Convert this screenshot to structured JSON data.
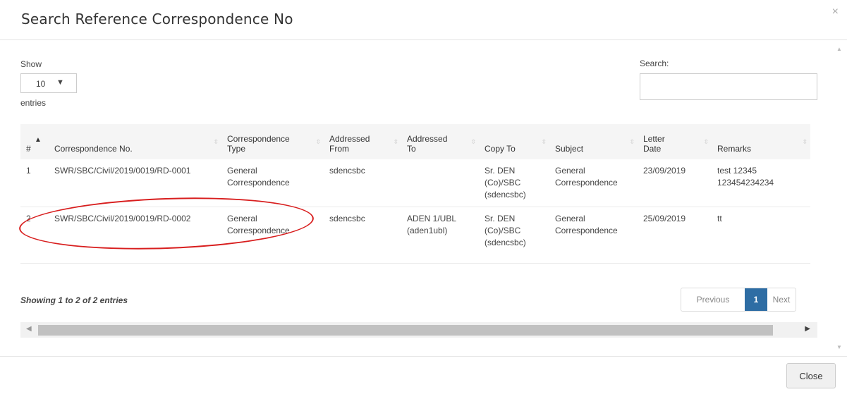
{
  "modal": {
    "title": "Search Reference Correspondence No",
    "close_symbol": "×"
  },
  "length": {
    "label_before": "Show",
    "value": "10",
    "caret": "▼",
    "label_after": "entries"
  },
  "search": {
    "label": "Search:",
    "value": ""
  },
  "table": {
    "columns": [
      "#",
      "Correspondence No.",
      "Correspondence Type",
      "Addressed From",
      "Addressed To",
      "Copy To",
      "Subject",
      "Letter Date",
      "Remarks"
    ],
    "rows": [
      {
        "num": "1",
        "corr_no": "SWR/SBC/Civil/2019/0019/RD-0001",
        "corr_type": "General Correspondence",
        "from": "sdencsbc",
        "to": "",
        "copy_to": "Sr. DEN (Co)/SBC (sdencsbc)",
        "subject": "General Correspondence",
        "date": "23/09/2019",
        "remarks": "test 12345 123454234234"
      },
      {
        "num": "2",
        "corr_no": "SWR/SBC/Civil/2019/0019/RD-0002",
        "corr_type": "General Correspondence",
        "from": "sdencsbc",
        "to": "ADEN 1/UBL (aden1ubl)",
        "copy_to": "Sr. DEN (Co)/SBC (sdencsbc)",
        "subject": "General Correspondence",
        "date": "25/09/2019",
        "remarks": "tt"
      }
    ]
  },
  "info": "Showing 1 to 2 of 2 entries",
  "pagination": {
    "previous": "Previous",
    "current": "1",
    "next": "Next"
  },
  "footer": {
    "close_label": "Close"
  },
  "colors": {
    "accent": "#2e6da4",
    "highlight": "#d81e1e"
  }
}
